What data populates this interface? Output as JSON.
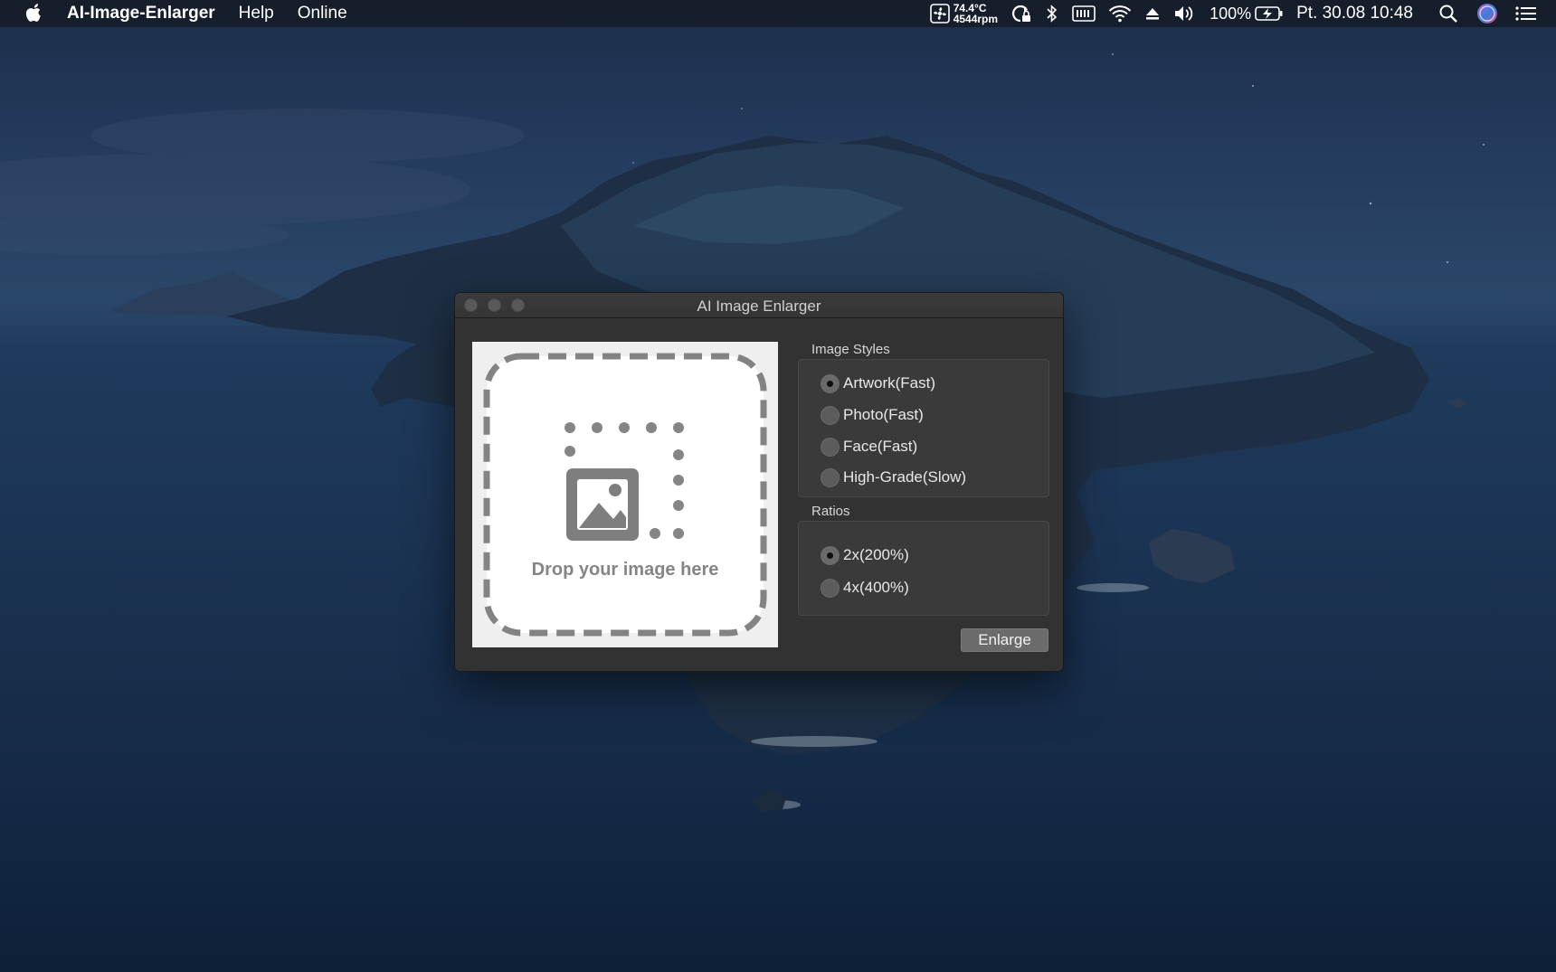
{
  "menubar": {
    "app_name": "AI-Image-Enlarger",
    "items": [
      "Help",
      "Online"
    ],
    "status": {
      "temperature": "74.4°C",
      "fan": "4544rpm",
      "battery": "100%",
      "datetime": "Pt. 30.08  10:48"
    },
    "icons": [
      "apple-icon",
      "fan-icon",
      "sync-lock-icon",
      "bluetooth-icon",
      "keyboard-icon",
      "wifi-icon",
      "eject-icon",
      "volume-icon",
      "battery-icon",
      "search-icon",
      "siri-icon",
      "list-icon"
    ]
  },
  "window": {
    "title": "AI Image Enlarger",
    "drop_text": "Drop your image here",
    "styles_label": "Image Styles",
    "styles": [
      {
        "label": "Artwork(Fast)",
        "selected": true
      },
      {
        "label": "Photo(Fast)",
        "selected": false
      },
      {
        "label": "Face(Fast)",
        "selected": false
      },
      {
        "label": "High-Grade(Slow)",
        "selected": false
      }
    ],
    "ratios_label": "Ratios",
    "ratios": [
      {
        "label": "2x(200%)",
        "selected": true
      },
      {
        "label": "4x(400%)",
        "selected": false
      }
    ],
    "enlarge_label": "Enlarge"
  }
}
